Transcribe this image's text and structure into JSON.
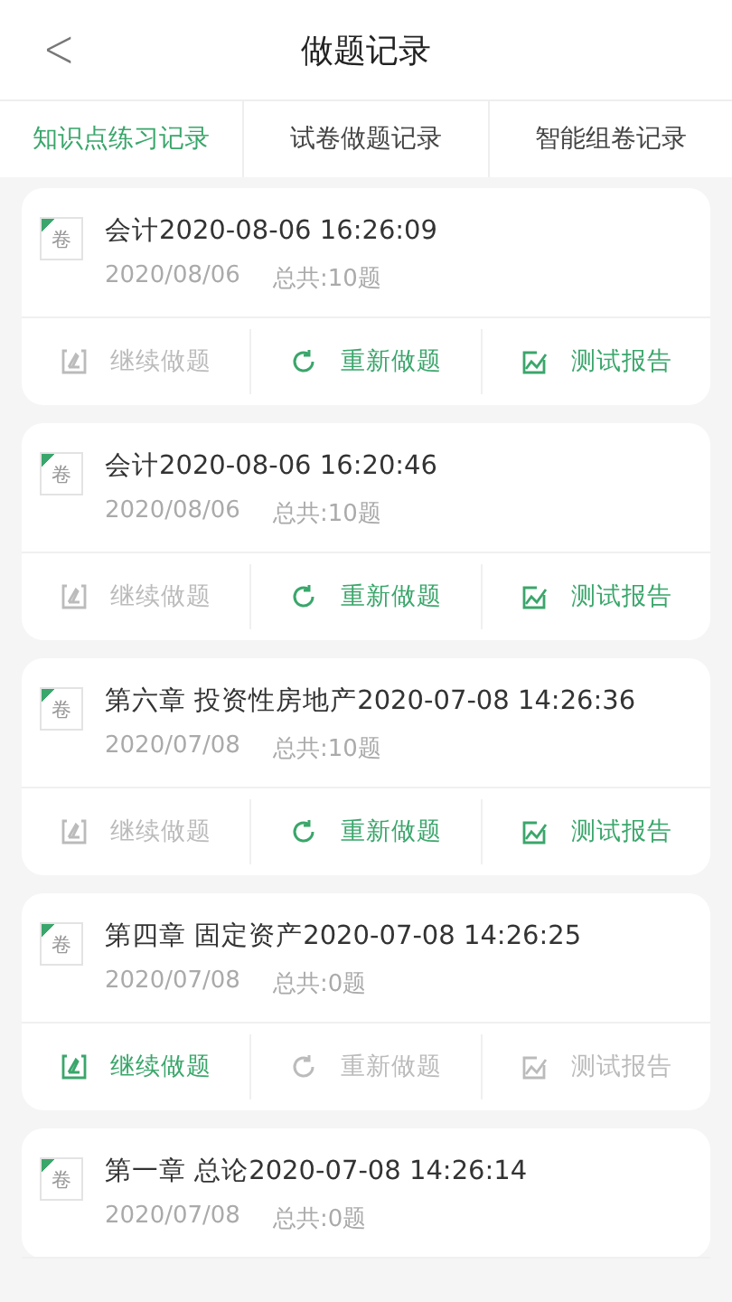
{
  "header": {
    "back": "<",
    "title": "做题记录"
  },
  "tabs": [
    {
      "label": "知识点练习记录",
      "selected": true
    },
    {
      "label": "试卷做题记录",
      "selected": false
    },
    {
      "label": "智能组卷记录",
      "selected": false
    }
  ],
  "records": [
    {
      "badge": "卷",
      "title": "会计2020-08-06 16:26:09",
      "date": "2020/08/06",
      "total": "总共:10题",
      "actions": [
        {
          "kind": "continue",
          "label": "继续做题",
          "disabled": true
        },
        {
          "kind": "redo",
          "label": "重新做题",
          "disabled": false
        },
        {
          "kind": "report",
          "label": "测试报告",
          "disabled": false
        }
      ]
    },
    {
      "badge": "卷",
      "title": "会计2020-08-06 16:20:46",
      "date": "2020/08/06",
      "total": "总共:10题",
      "actions": [
        {
          "kind": "continue",
          "label": "继续做题",
          "disabled": true
        },
        {
          "kind": "redo",
          "label": "重新做题",
          "disabled": false
        },
        {
          "kind": "report",
          "label": "测试报告",
          "disabled": false
        }
      ]
    },
    {
      "badge": "卷",
      "title": "第六章 投资性房地产2020-07-08 14:26:36",
      "date": "2020/07/08",
      "total": "总共:10题",
      "actions": [
        {
          "kind": "continue",
          "label": "继续做题",
          "disabled": true
        },
        {
          "kind": "redo",
          "label": "重新做题",
          "disabled": false
        },
        {
          "kind": "report",
          "label": "测试报告",
          "disabled": false
        }
      ]
    },
    {
      "badge": "卷",
      "title": "第四章 固定资产2020-07-08 14:26:25",
      "date": "2020/07/08",
      "total": "总共:0题",
      "actions": [
        {
          "kind": "continue",
          "label": "继续做题",
          "disabled": false
        },
        {
          "kind": "redo",
          "label": "重新做题",
          "disabled": true
        },
        {
          "kind": "report",
          "label": "测试报告",
          "disabled": true
        }
      ]
    },
    {
      "badge": "卷",
      "title": "第一章 总论2020-07-08 14:26:14",
      "date": "2020/07/08",
      "total": "总共:0题"
    }
  ]
}
